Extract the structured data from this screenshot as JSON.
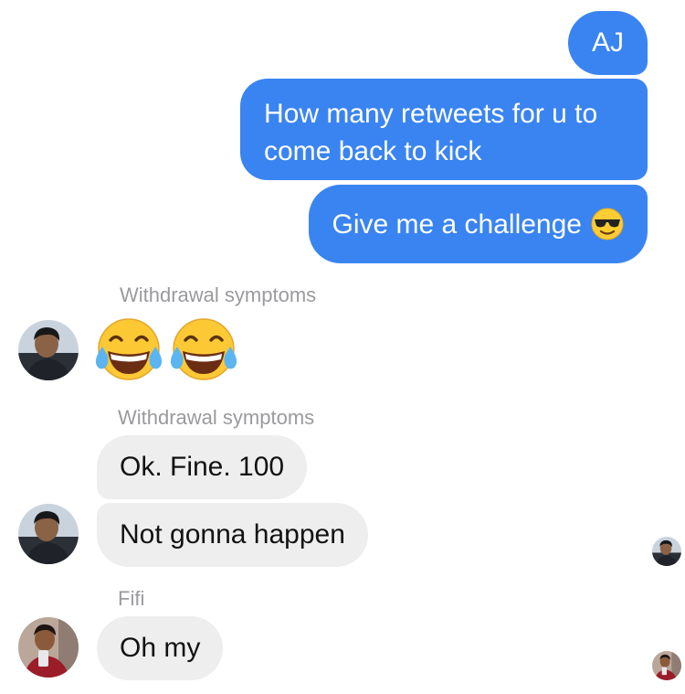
{
  "outgoing": [
    {
      "text": "AJ"
    },
    {
      "text": "How many retweets for u to come back to kick"
    },
    {
      "text": "Give me a challenge",
      "emoji_icon": "sunglasses-face-emoji"
    }
  ],
  "groups": [
    {
      "sender": "Withdrawal symptoms",
      "emoji_message": [
        "tears-of-joy-emoji",
        "tears-of-joy-emoji"
      ]
    },
    {
      "sender": "Withdrawal symptoms",
      "messages": [
        "Ok. Fine. 100",
        "Not gonna happen"
      ]
    },
    {
      "sender": "Fifi",
      "messages": [
        "Oh my"
      ]
    }
  ],
  "colors": {
    "outgoing_bubble": "#3a84f1",
    "incoming_bubble": "#eeeeef",
    "sender_label": "#9a9a9e"
  },
  "read_receipts": [
    "withdrawal-symptoms-avatar",
    "fifi-avatar"
  ]
}
